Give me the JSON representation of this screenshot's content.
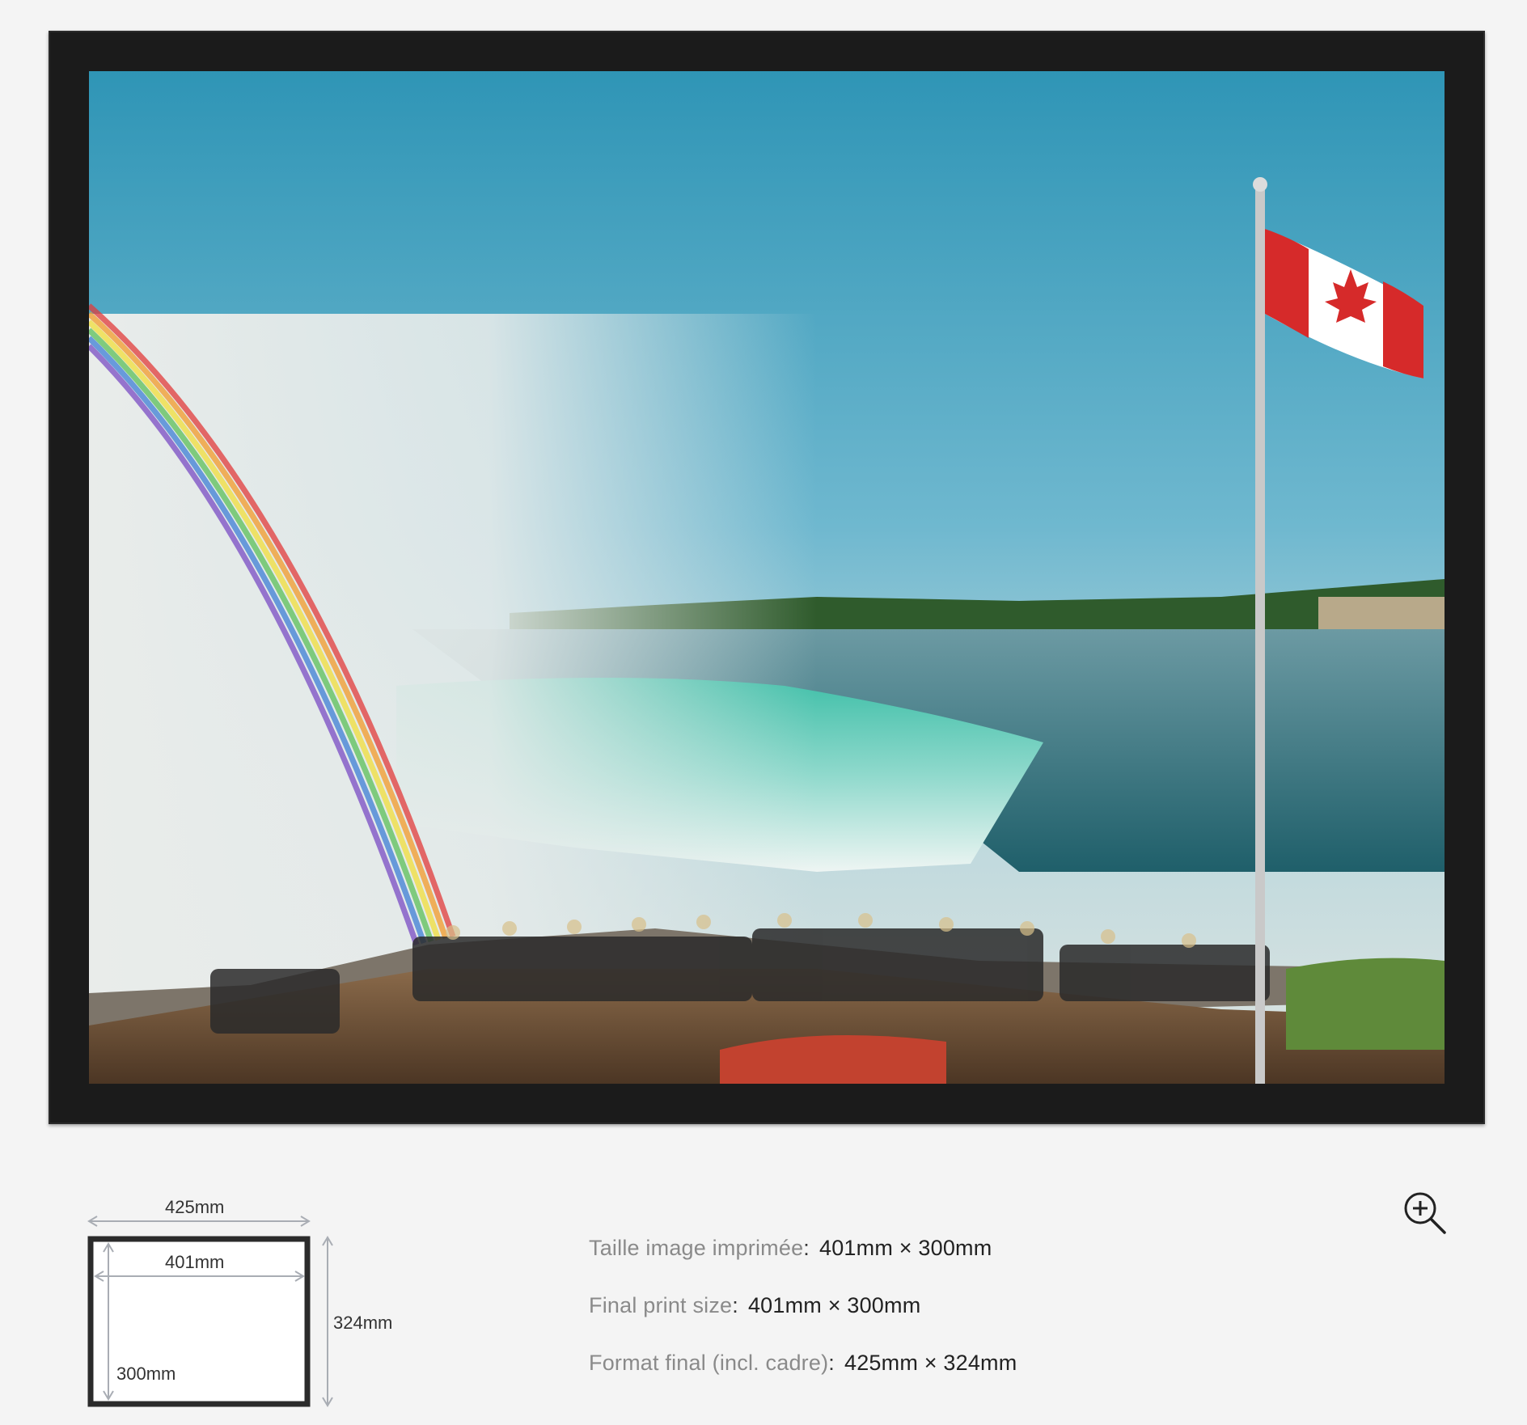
{
  "artwork": {
    "photo_alt_icon": "photo-niagara-falls",
    "frame_color": "#1b1b1b"
  },
  "diagram": {
    "outer_width": "425mm",
    "inner_width": "401mm",
    "outer_height": "324mm",
    "inner_height": "300mm"
  },
  "info": {
    "rows": [
      {
        "label": "Taille image imprimée",
        "sep": ":",
        "value": "401mm × 300mm"
      },
      {
        "label": "Final print size",
        "sep": ":",
        "value": "401mm × 300mm"
      },
      {
        "label": "Format final (incl. cadre)",
        "sep": ":",
        "value": "425mm × 324mm"
      }
    ]
  },
  "zoom": {
    "icon": "zoom-in-icon"
  },
  "colors": {
    "background": "#f4f4f4",
    "label_grey": "#8a8a8a",
    "text_dark": "#222222",
    "arrow_grey": "#a9adb4"
  }
}
